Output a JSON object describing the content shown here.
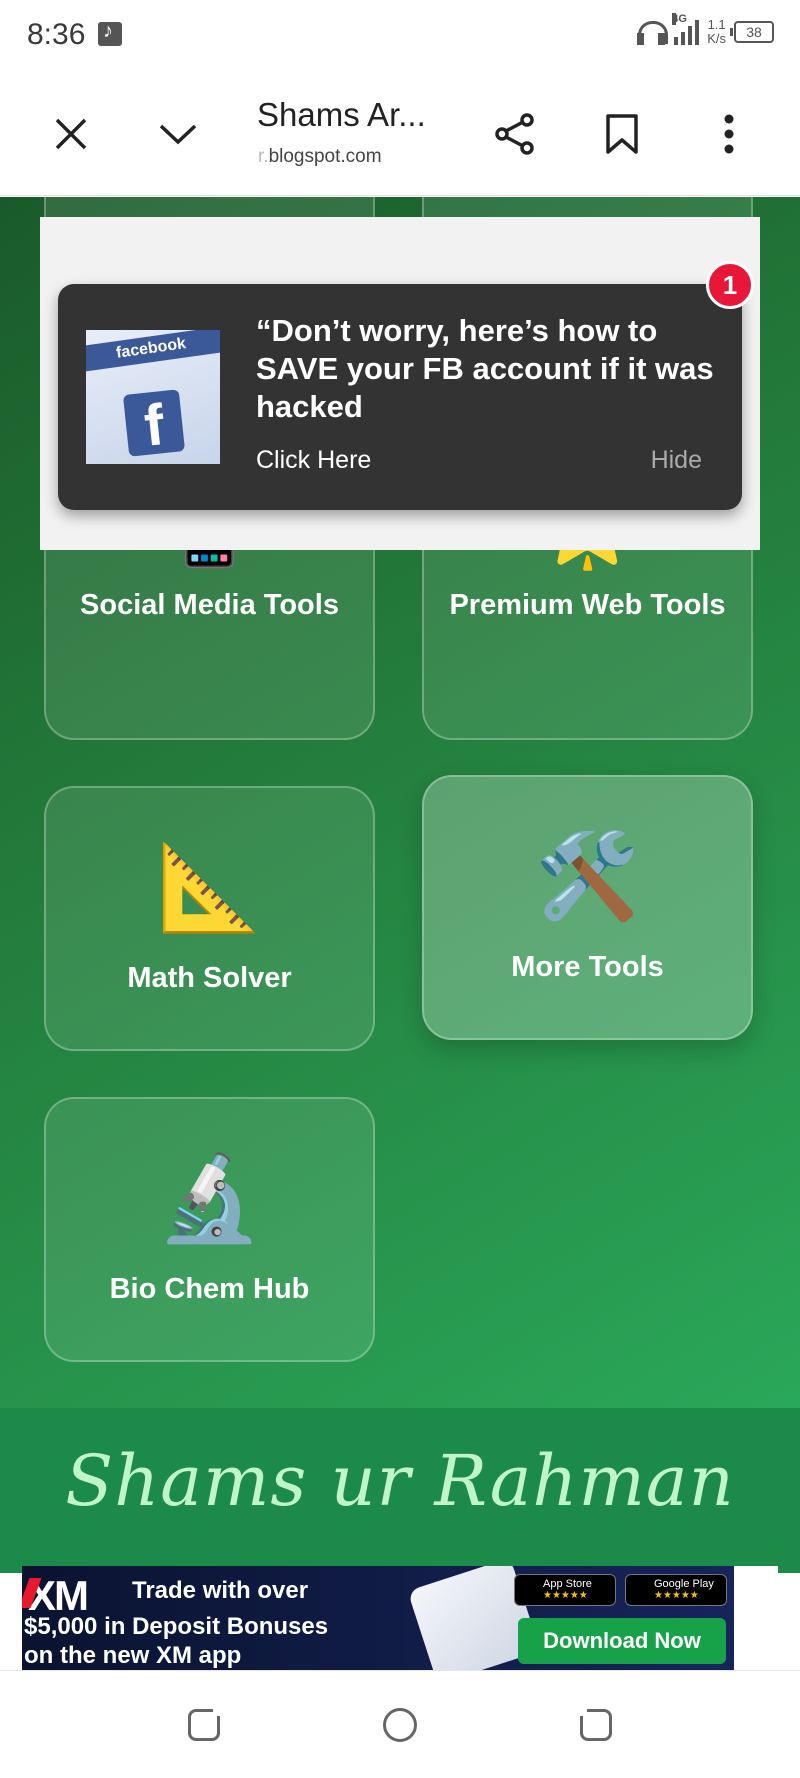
{
  "status_bar": {
    "time": "8:36",
    "network": "4G",
    "speed_value": "1.1",
    "speed_unit": "K/s",
    "battery": "38"
  },
  "browser": {
    "title": "Shams Ar...",
    "url_faded": "r.",
    "url": "blogspot.com"
  },
  "tool_cards": [
    {
      "label": "Social Media Tools",
      "icon": "mobile-phone-icon"
    },
    {
      "label": "Premium Web Tools",
      "icon": "star-icon"
    },
    {
      "label": "Math Solver",
      "icon": "triangle-ruler-icon"
    },
    {
      "label": "More Tools",
      "icon": "hammer-wrench-icon"
    },
    {
      "label": "Bio Chem Hub",
      "icon": "microscope-icon"
    }
  ],
  "signature": "Shams ur Rahman",
  "popup": {
    "headline": "“Don’t worry, here’s how to SAVE your FB account if it was hacked",
    "cta": "Click Here",
    "hide": "Hide",
    "badge": "1",
    "thumb_text": "facebook",
    "thumb_letter": "f"
  },
  "ad": {
    "brand": "XM",
    "line1": "Trade with over",
    "line2": "$5,000 in Deposit Bonuses",
    "line3": "on the new XM app",
    "store1": "App Store",
    "store2": "Google Play",
    "stars": "★★★★★",
    "cta": "Download Now"
  },
  "colors": {
    "page_green_dark": "#1a5a2a",
    "page_green_light": "#2aa85a",
    "popup_bg": "#333333",
    "badge_red": "#e8173a",
    "ad_cta_green": "#17a24a"
  }
}
